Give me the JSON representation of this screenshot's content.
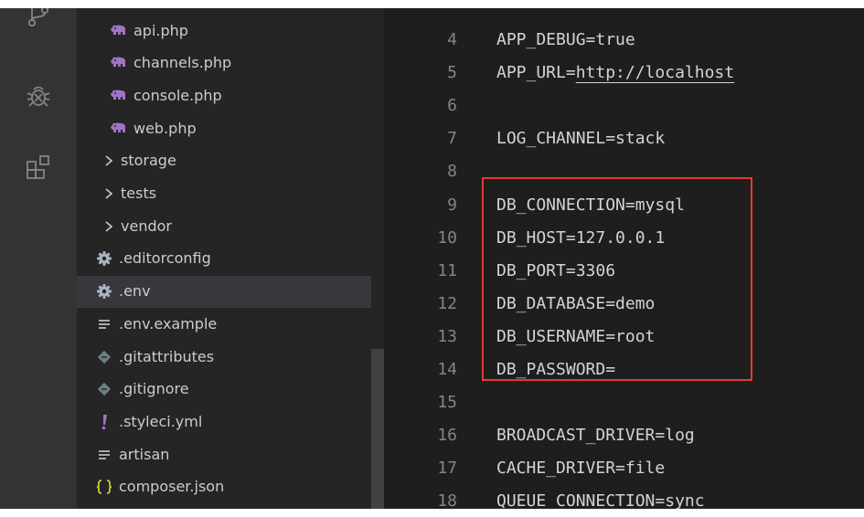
{
  "activity_bar": {
    "items": [
      {
        "icon": "source-control-icon"
      },
      {
        "icon": "debug-icon"
      },
      {
        "icon": "extensions-icon"
      }
    ]
  },
  "explorer": {
    "items": [
      {
        "label": "api.php",
        "icon": "php-elephant-icon"
      },
      {
        "label": "channels.php",
        "icon": "php-elephant-icon"
      },
      {
        "label": "console.php",
        "icon": "php-elephant-icon"
      },
      {
        "label": "web.php",
        "icon": "php-elephant-icon"
      },
      {
        "label": "storage",
        "icon": "chevron-right-icon"
      },
      {
        "label": "tests",
        "icon": "chevron-right-icon"
      },
      {
        "label": "vendor",
        "icon": "chevron-right-icon"
      },
      {
        "label": ".editorconfig",
        "icon": "gear-icon"
      },
      {
        "label": ".env",
        "icon": "gear-icon",
        "selected": true
      },
      {
        "label": ".env.example",
        "icon": "lines-icon"
      },
      {
        "label": ".gitattributes",
        "icon": "git-diamond-icon"
      },
      {
        "label": ".gitignore",
        "icon": "git-diamond-icon"
      },
      {
        "label": ".styleci.yml",
        "icon": "exclamation-icon"
      },
      {
        "label": "artisan",
        "icon": "lines-icon"
      },
      {
        "label": "composer.json",
        "icon": "braces-icon"
      }
    ]
  },
  "editor": {
    "lines": [
      {
        "num": "4",
        "text": "APP_DEBUG=true"
      },
      {
        "num": "5",
        "text": "APP_URL=",
        "url": "http://localhost"
      },
      {
        "num": "6",
        "text": ""
      },
      {
        "num": "7",
        "text": "LOG_CHANNEL=stack"
      },
      {
        "num": "8",
        "text": ""
      },
      {
        "num": "9",
        "text": "DB_CONNECTION=mysql"
      },
      {
        "num": "10",
        "text": "DB_HOST=127.0.0.1"
      },
      {
        "num": "11",
        "text": "DB_PORT=3306"
      },
      {
        "num": "12",
        "text": "DB_DATABASE=demo"
      },
      {
        "num": "13",
        "text": "DB_USERNAME=root"
      },
      {
        "num": "14",
        "text": "DB_PASSWORD="
      },
      {
        "num": "15",
        "text": ""
      },
      {
        "num": "16",
        "text": "BROADCAST_DRIVER=log"
      },
      {
        "num": "17",
        "text": "CACHE_DRIVER=file"
      },
      {
        "num": "18",
        "text": "QUEUE_CONNECTION=sync"
      }
    ]
  },
  "colors": {
    "highlight_border": "#e53935",
    "php_icon": "#a074c4",
    "gear_icon": "#a9b2c3",
    "git_icon": "#6d8086",
    "yaml_icon": "#a074c4",
    "json_icon": "#cbcb41"
  }
}
